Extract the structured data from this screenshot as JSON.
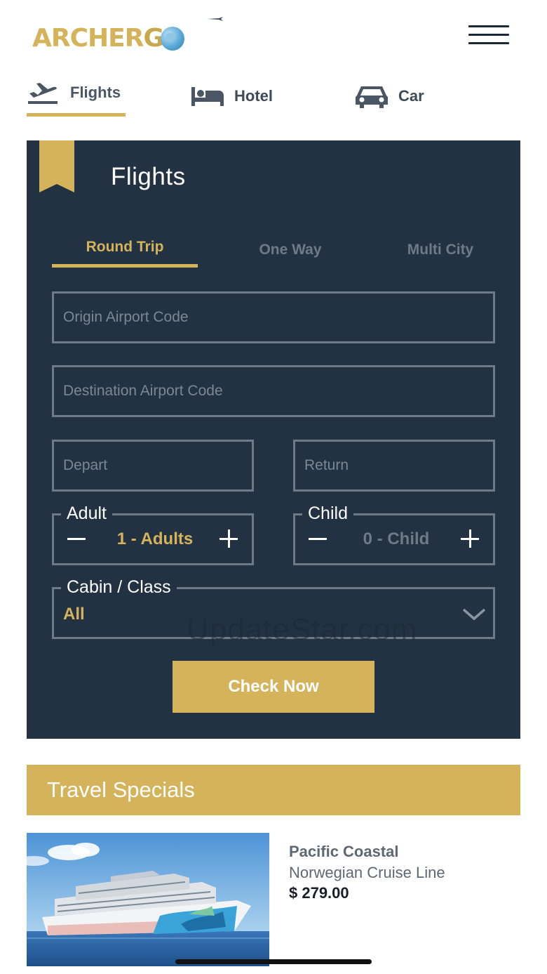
{
  "header": {
    "logo_text_archer": "ARCHER",
    "logo_text_go": "G",
    "menu_icon": "hamburger-menu-icon"
  },
  "top_tabs": [
    {
      "label": "Flights",
      "icon": "airplane-departure-icon",
      "active": true
    },
    {
      "label": "Hotel",
      "icon": "bed-icon",
      "active": false
    },
    {
      "label": "Car",
      "icon": "car-icon",
      "active": false
    }
  ],
  "search": {
    "title": "Flights",
    "trip_tabs": [
      {
        "label": "Round Trip",
        "active": true
      },
      {
        "label": "One Way",
        "active": false
      },
      {
        "label": "Multi City",
        "active": false
      }
    ],
    "origin_placeholder": "Origin Airport Code",
    "destination_placeholder": "Destination Airport Code",
    "depart_placeholder": "Depart",
    "return_placeholder": "Return",
    "adult": {
      "legend": "Adult",
      "value": "1 - Adults"
    },
    "child": {
      "legend": "Child",
      "value": "0 - Child"
    },
    "cabin": {
      "legend": "Cabin / Class",
      "value": "All"
    },
    "submit_label": "Check Now"
  },
  "watermark": "UpdateStar.com",
  "specials": {
    "title": "Travel Specials",
    "deals": [
      {
        "name": "Pacific Coastal",
        "line": "Norwegian Cruise Line",
        "price": "$ 279.00",
        "image": "cruise-ship-photo"
      }
    ]
  },
  "colors": {
    "accent_gold": "#d4b35a",
    "panel_navy": "#233242",
    "field_border": "#6e7a87"
  }
}
